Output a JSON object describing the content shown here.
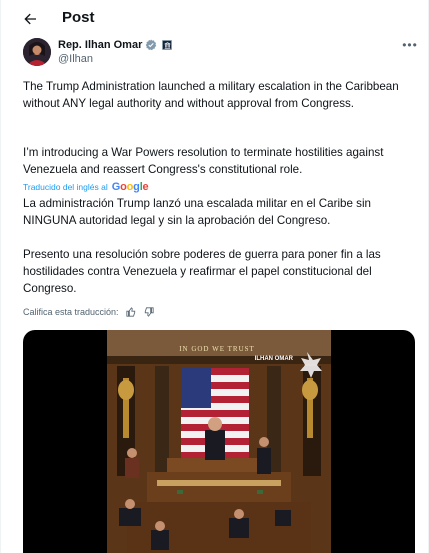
{
  "header": {
    "title": "Post",
    "back_icon": "arrow-left-icon"
  },
  "author": {
    "name": "Rep. Ilhan Omar",
    "handle": "@Ilhan",
    "verified_color": "#1d9bf0",
    "affiliation_icon": "government-badge-icon"
  },
  "tweet": {
    "paragraph_1": "The Trump Administration launched a military escalation in the Caribbean without ANY legal authority and without approval from Congress.",
    "paragraph_2": "I’m introducing a War Powers resolution to terminate hostilities against Venezuela and reassert Congress's constitutional role.",
    "translated_label": "Traducido del inglés al",
    "translator": "Google",
    "translation_1": "La administración Trump lanzó una escalada militar en el Caribe sin NINGUNA autoridad legal y sin la aprobación del Congreso.",
    "translation_2": "Presento una resolución sobre poderes de guerra para poner fin a las hostilidades contra Venezuela y reafirmar el papel constitucional del Congreso.",
    "rate_label": "Califica esta traducción:"
  },
  "media": {
    "inscription": "IN GOD WE TRUST",
    "watermark": "ILHAN OMAR"
  },
  "colors": {
    "accent": "#1d9bf0",
    "text": "#0f1419",
    "secondary": "#536471"
  }
}
